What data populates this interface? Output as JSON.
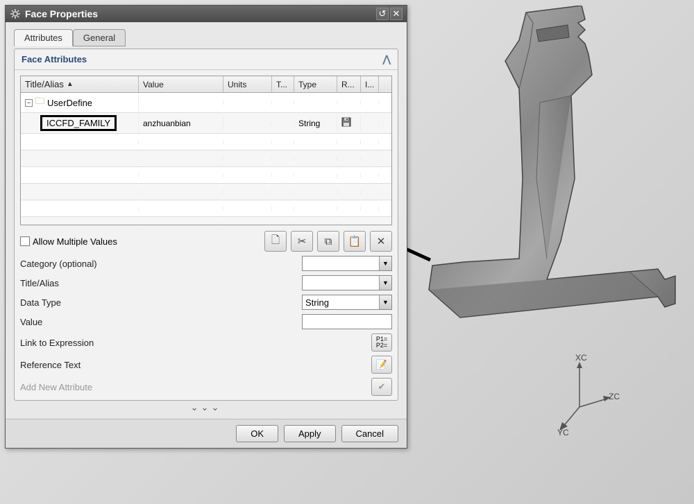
{
  "window": {
    "title": "Face Properties"
  },
  "tabs": {
    "attributes": "Attributes",
    "general": "General"
  },
  "section": {
    "title": "Face Attributes"
  },
  "grid": {
    "columns": {
      "title": "Title/Alias",
      "value": "Value",
      "units": "Units",
      "t": "T...",
      "type": "Type",
      "r": "R...",
      "i": "I..."
    },
    "sort_indicator": "▲",
    "group": "UserDefine",
    "rows": [
      {
        "title": "ICCFD_FAMILY",
        "value": "anzhuanbian",
        "units": "",
        "t": "",
        "type": "String",
        "r_icon": "disk-icon",
        "i": ""
      }
    ]
  },
  "controls": {
    "allow_multiple": "Allow Multiple Values",
    "category_label": "Category (optional)",
    "title_label": "Title/Alias",
    "datatype_label": "Data Type",
    "datatype_value": "String",
    "value_label": "Value",
    "link_label": "Link to Expression",
    "reftext_label": "Reference Text",
    "addnew_label": "Add New Attribute"
  },
  "buttons": {
    "ok": "OK",
    "apply": "Apply",
    "cancel": "Cancel"
  },
  "expand_footer": "⌄⌄⌄",
  "triad": {
    "xc": "XC",
    "yc": "YC",
    "zc": "ZC"
  }
}
